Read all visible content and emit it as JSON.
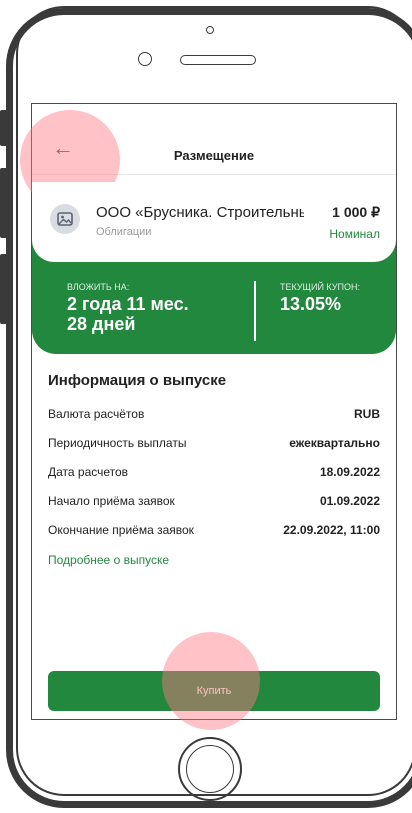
{
  "header": {
    "title": "Размещение"
  },
  "asset": {
    "name": "ООО «Брусника. Строительный",
    "type": "Облигации",
    "price": "1 000 ₽",
    "price_label": "Номинал"
  },
  "summary": {
    "invest_label": "ВЛОЖИТЬ НА:",
    "invest_line1": "2 года 11 мес.",
    "invest_line2": "28 дней",
    "coupon_label": "ТЕКУЩИЙ КУПОН:",
    "coupon_value": "13.05%"
  },
  "info": {
    "title": "Информация о выпуске",
    "rows": [
      {
        "label": "Валюта расчётов",
        "value": "RUB"
      },
      {
        "label": "Периодичность выплаты",
        "value": "ежеквартально"
      },
      {
        "label": "Дата расчетов",
        "value": "18.09.2022"
      },
      {
        "label": "Начало приёма заявок",
        "value": "01.09.2022"
      },
      {
        "label": "Окончание приёма заявок",
        "value": "22.09.2022, 11:00"
      }
    ],
    "more_link": "Подробнее о выпуске"
  },
  "buy_button": "Купить",
  "colors": {
    "accent": "#21883e",
    "tap_marker": "#ff7882"
  },
  "icons": {
    "back": "arrow-left-icon",
    "asset": "image-placeholder-icon"
  }
}
